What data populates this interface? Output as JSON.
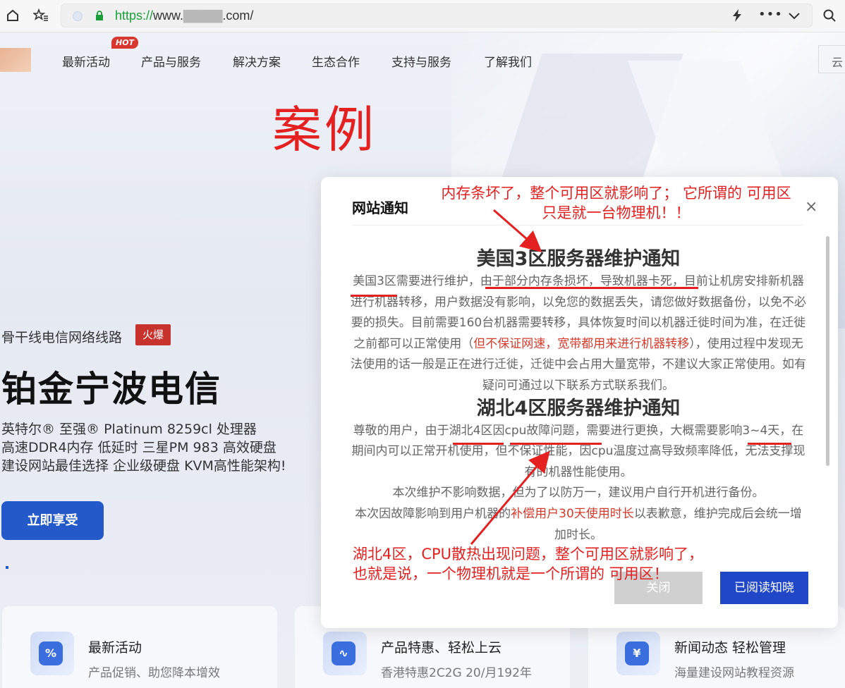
{
  "browser": {
    "url_scheme": "https://",
    "url_host": "www.",
    "url_mask": "▇▇▇▇",
    "url_tld": ".com/",
    "icons": [
      "home-icon",
      "bookmarks-icon",
      "lightning-icon",
      "more-icon",
      "chevron-down-icon",
      "search-icon"
    ]
  },
  "nav": {
    "hot": "HOT",
    "items": [
      "最新活动",
      "产品与服务",
      "解决方案",
      "生态合作",
      "支持与服务",
      "了解我们"
    ],
    "right_text": "云"
  },
  "annotation_title": "案例",
  "hero": {
    "subtitle": "骨干线电信网络线路",
    "tag": "火爆",
    "title": "铂金宁波电信",
    "lines": [
      "英特尔® 至强® Platinum 8259cl 处理器",
      "高速DDR4内存 低延时 三星PM 983 高效硬盘",
      "建设网站最佳选择 企业级硬盘 KVM高性能架构!"
    ],
    "cta": "立即享受"
  },
  "cards": [
    {
      "title": "最新活动",
      "subtitle": "产品促销、助您降本增效",
      "icon": "gift-percent-icon",
      "glyph": "%"
    },
    {
      "title": "产品特惠、轻松上云",
      "subtitle": "香港特惠2C2G 20/月192年",
      "icon": "pulse-monitor-icon",
      "glyph": "∿"
    },
    {
      "title": "新闻动态 轻松管理",
      "subtitle": "海量建设网站教程资源",
      "icon": "yen-document-icon",
      "glyph": "¥"
    }
  ],
  "modal": {
    "title": "网站通知",
    "close_label": "×",
    "notice1_heading": "美国3区服务器维护通知",
    "notice1_p1": "美国3区需要进行维护，由于部分内存条损坏，导致机器卡死，目前让机房安排新机器进行机器转移，用户数据没有影响，以免您的数据丢失，请您做好数据备份，以免不必要的损失。目前需要160台机器需要转移，具体恢复时间以机器迁徙时间为准，在迁徙之前都可以正常使用（",
    "notice1_red1": "但不保证网速",
    "notice1_sep": "，",
    "notice1_red2": "宽带都用来进行机器转移",
    "notice1_p2": "），使用过程中发现无法使用的话一般是正在进行迁徙，迁徙中会占用大量宽带，不建议大家正常使用。如有疑问可通过以下联系方式联系我们。",
    "notice2_heading": "湖北4区服务器维护通知",
    "notice2_p1": "尊敬的用户，由于湖北4区因cpu故障问题，需要进行更换，大概需要影响3~4天，在期间内可以正常开机使用，但不保证性能，因cpu温度过高导致频率降低，无法支撑现有的机器性能使用。",
    "notice2_p2": "本次维护不影响数据，但为了以防万一，建议用户自行开机进行备份。",
    "notice2_p3a": "本次因故障影响到用户机器的",
    "notice2_red": "补偿用户30天使用时长",
    "notice2_p3b": "以表歉意，维护完成后会统一增加时长。",
    "btn_close": "关闭",
    "btn_ok": "已阅读知晓"
  },
  "annotations": {
    "top_line1": "内存条坏了，整个可用区就影响了；  它所谓的 可用区",
    "top_line2": "只是就一台物理机！！",
    "bottom_line1": "湖北4区，CPU散热出现问题，整个可用区就影响了，",
    "bottom_line2": "也就是说，一个物理机就是一个所谓的 可用区！"
  },
  "colors": {
    "annotation_red": "#e42020",
    "primary_blue": "#2459c9",
    "modal_ok_blue": "#1f47c8",
    "notice_red": "#d63a2a",
    "url_green": "#1a9d3a"
  }
}
